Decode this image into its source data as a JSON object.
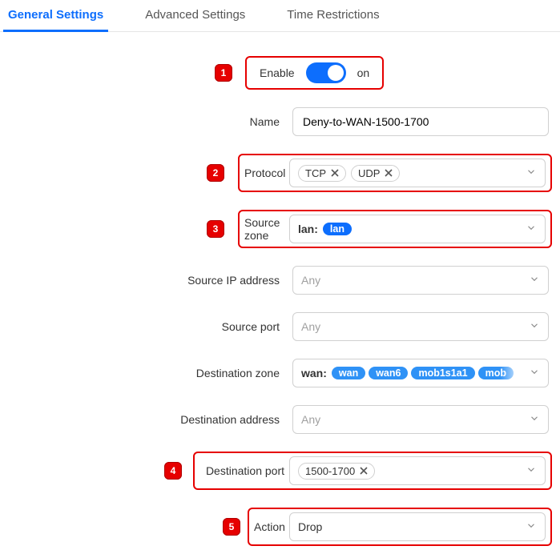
{
  "tabs": {
    "general": "General Settings",
    "advanced": "Advanced Settings",
    "time": "Time Restrictions"
  },
  "markers": {
    "m1": "1",
    "m2": "2",
    "m3": "3",
    "m4": "4",
    "m5": "5"
  },
  "enable": {
    "label": "Enable",
    "state_text": "on"
  },
  "name": {
    "label": "Name",
    "value": "Deny-to-WAN-1500-1700"
  },
  "protocol": {
    "label": "Protocol",
    "tag1": "TCP",
    "tag2": "UDP"
  },
  "source_zone": {
    "label": "Source zone",
    "prefix": "lan:",
    "pill1": "lan"
  },
  "source_ip": {
    "label": "Source IP address",
    "placeholder": "Any"
  },
  "source_port": {
    "label": "Source port",
    "placeholder": "Any"
  },
  "dest_zone": {
    "label": "Destination zone",
    "prefix": "wan:",
    "pill1": "wan",
    "pill2": "wan6",
    "pill3": "mob1s1a1",
    "pill4": "mob"
  },
  "dest_addr": {
    "label": "Destination address",
    "placeholder": "Any"
  },
  "dest_port": {
    "label": "Destination port",
    "tag1": "1500-1700"
  },
  "action": {
    "label": "Action",
    "value": "Drop"
  }
}
